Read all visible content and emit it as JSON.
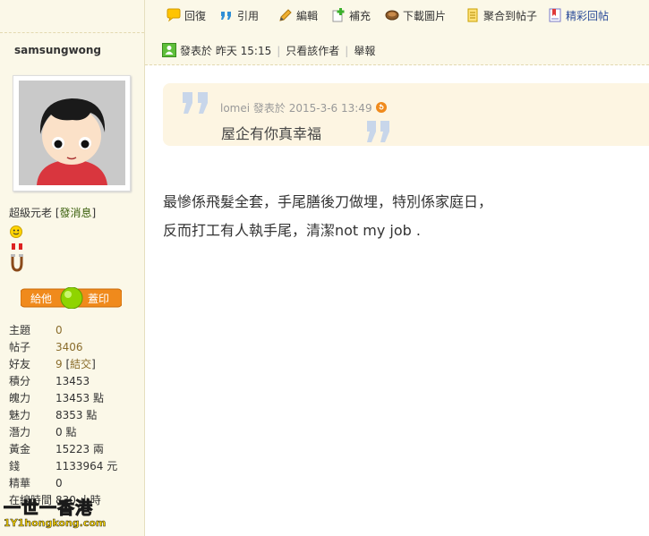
{
  "toolbar": {
    "reply": "回復",
    "quote": "引用",
    "edit": "編輯",
    "supplement": "補充",
    "download_images": "下載圖片",
    "aggregate": "聚合到帖子",
    "featured_replies": "精彩回帖"
  },
  "post_header": {
    "posted_at": "發表於 昨天 15:15",
    "author_only": "只看該作者",
    "report": "舉報"
  },
  "sidebar": {
    "username": "samsungwong",
    "rank": "超級元老",
    "send_message": "發消息",
    "give_label": "給他",
    "stamp_label": "蓋印",
    "stats": [
      {
        "key": "主題",
        "value": "0",
        "link": true
      },
      {
        "key": "帖子",
        "value": "3406",
        "link": true
      },
      {
        "key": "好友",
        "value": "9",
        "extra": "結交",
        "link": true
      },
      {
        "key": "積分",
        "value": "13453",
        "link": false
      },
      {
        "key": "魄力",
        "value": "13453 點",
        "link": false
      },
      {
        "key": "魅力",
        "value": "8353 點",
        "link": false
      },
      {
        "key": "潛力",
        "value": "0 點",
        "link": false
      },
      {
        "key": "黃金",
        "value": "15223 兩",
        "link": false
      },
      {
        "key": "錢",
        "value": "1133964 元",
        "link": false
      },
      {
        "key": "精華",
        "value": "0",
        "link": false
      },
      {
        "key": "在線時間",
        "value": "830 小時",
        "link": false
      }
    ],
    "watermark_text": "一世一香港",
    "watermark_url": "1Y1hongkong.com"
  },
  "quote": {
    "meta": "lomei 發表於 2015-3-6 13:49",
    "text": "屋企有你真幸福"
  },
  "message": {
    "line1": "最慘係飛髮全套，手尾膳後刀做埋，特別係家庭日，",
    "line2": "反而打工有人執手尾，清潔not my job ."
  },
  "colors": {
    "sidebar_bg": "#fbf8e8",
    "quote_bg": "#fdf5e2",
    "link_blue": "#2b4c9a",
    "accent_orange": "#f08a1c"
  }
}
